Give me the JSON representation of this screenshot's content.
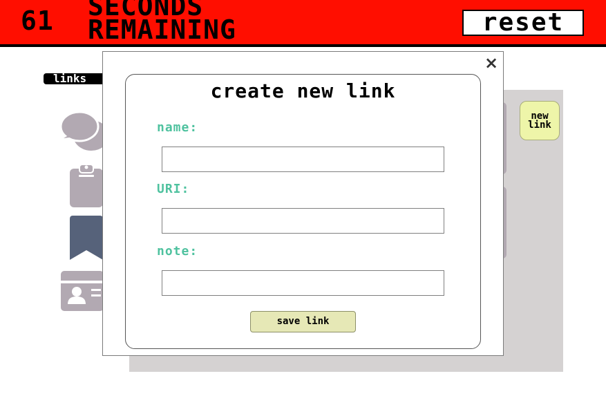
{
  "timer": {
    "seconds": "61",
    "label": "SECONDS\nREMAINING",
    "bar_color": "#ff0e00"
  },
  "header": {
    "reset_label": "reset"
  },
  "sidebar": {
    "tab_label": "links",
    "icons": [
      "chat-icon",
      "clipboard-icon",
      "bookmark-icon",
      "id-card-icon"
    ]
  },
  "main": {
    "new_link_label": "new\nlink"
  },
  "modal": {
    "close_glyph": "×",
    "title": "create new link",
    "fields": [
      {
        "label": "name:",
        "value": "",
        "placeholder": ""
      },
      {
        "label": "URI:",
        "value": "",
        "placeholder": ""
      },
      {
        "label": "note:",
        "value": "",
        "placeholder": ""
      }
    ],
    "save_label": "save link",
    "label_color": "#4fc29f",
    "button_color": "#e6e8b6"
  }
}
